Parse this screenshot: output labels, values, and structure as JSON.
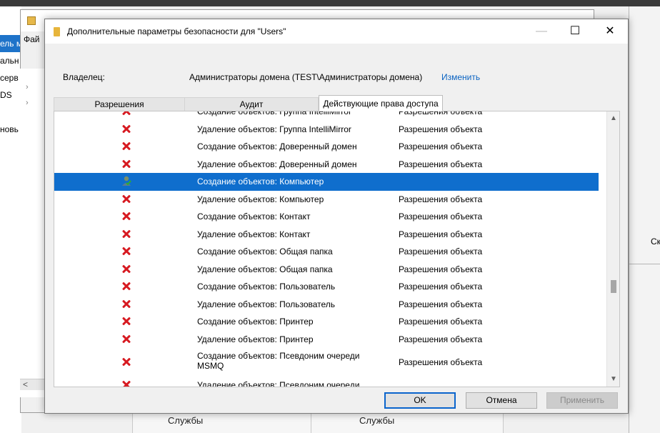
{
  "background": {
    "left_items": [
      "ель м",
      "альн",
      "серв",
      "DS",
      "",
      "новь"
    ],
    "window_menu": "Фай",
    "tree_arrows": [
      "›",
      "›",
      "˅"
    ],
    "scroll_left": "<",
    "right_text": "Ск",
    "bottom_tabs": [
      "Службы",
      "Службы"
    ]
  },
  "dialog": {
    "title": "Дополнительные параметры безопасности  для \"Users\"",
    "owner_label": "Владелец:",
    "owner_value": "Администраторы домена (TEST\\Администраторы домена)",
    "owner_change": "Изменить",
    "tabs": [
      {
        "label": "Разрешения",
        "active": false
      },
      {
        "label": "Аудит",
        "active": false
      },
      {
        "label": "Действующие права доступа",
        "active": true
      }
    ],
    "rows": [
      {
        "icon": "deny-x-icon",
        "name": "Создание объектов: Группа IntelliMirror",
        "inheritance": "Разрешения объекта",
        "partial": "top"
      },
      {
        "icon": "deny-x-icon",
        "name": "Удаление объектов: Группа IntelliMirror",
        "inheritance": "Разрешения объекта"
      },
      {
        "icon": "deny-x-icon",
        "name": "Создание объектов: Доверенный домен",
        "inheritance": "Разрешения объекта"
      },
      {
        "icon": "deny-x-icon",
        "name": "Удаление объектов: Доверенный домен",
        "inheritance": "Разрешения объекта"
      },
      {
        "icon": "allow-user-icon",
        "name": "Создание объектов: Компьютер",
        "inheritance": "",
        "selected": true
      },
      {
        "icon": "deny-x-icon",
        "name": "Удаление объектов: Компьютер",
        "inheritance": "Разрешения объекта"
      },
      {
        "icon": "deny-x-icon",
        "name": "Создание объектов: Контакт",
        "inheritance": "Разрешения объекта"
      },
      {
        "icon": "deny-x-icon",
        "name": "Удаление объектов: Контакт",
        "inheritance": "Разрешения объекта"
      },
      {
        "icon": "deny-x-icon",
        "name": "Создание объектов: Общая папка",
        "inheritance": "Разрешения объекта"
      },
      {
        "icon": "deny-x-icon",
        "name": "Удаление объектов: Общая папка",
        "inheritance": "Разрешения объекта"
      },
      {
        "icon": "deny-x-icon",
        "name": "Создание объектов: Пользователь",
        "inheritance": "Разрешения объекта"
      },
      {
        "icon": "deny-x-icon",
        "name": "Удаление объектов: Пользователь",
        "inheritance": "Разрешения объекта"
      },
      {
        "icon": "deny-x-icon",
        "name": "Создание объектов: Принтер",
        "inheritance": "Разрешения объекта"
      },
      {
        "icon": "deny-x-icon",
        "name": "Удаление объектов: Принтер",
        "inheritance": "Разрешения объекта"
      },
      {
        "icon": "deny-x-icon",
        "name": "Создание объектов: Псевдоним очереди MSMQ",
        "inheritance": "Разрешения объекта",
        "tall": true
      },
      {
        "icon": "deny-x-icon",
        "name": "Удаление объектов: Псевдоним очереди",
        "inheritance": "",
        "partial": "bottom"
      }
    ],
    "scroll_position": 0.66,
    "buttons": {
      "ok": "OK",
      "cancel": "Отмена",
      "apply": "Применить"
    }
  },
  "colors": {
    "selection": "#0f6ecd",
    "deny": "#d71a21",
    "link": "#0a63c2"
  }
}
